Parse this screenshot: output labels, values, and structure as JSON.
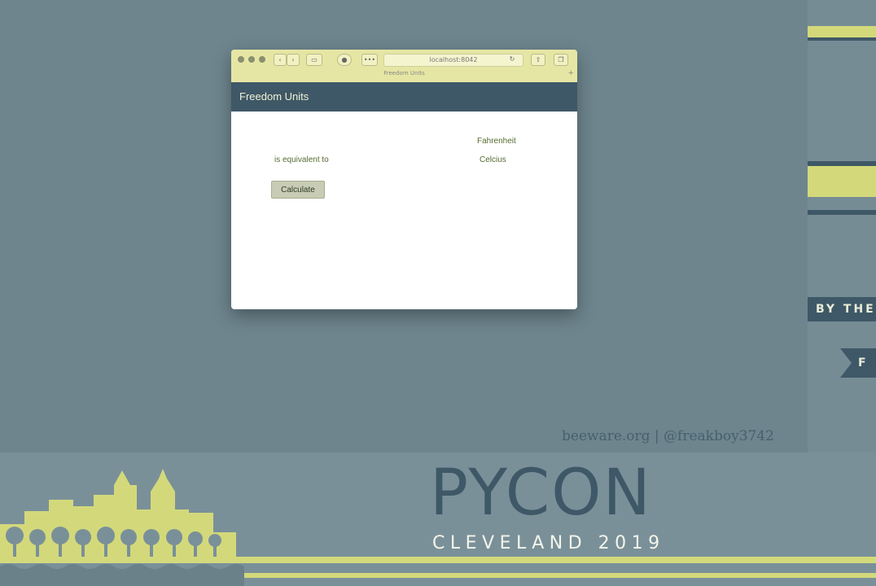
{
  "browser": {
    "url": "localhost:8042",
    "tab_title": "Freedom Units"
  },
  "app": {
    "title": "Freedom Units",
    "fahrenheit_label": "Fahrenheit",
    "equivalent_label": "is equivalent to",
    "celsius_label": "Celcius",
    "calculate_label": "Calculate"
  },
  "slide": {
    "credit": "beeware.org | @freakboy3742",
    "side_text": "BY THE",
    "side_ribbon": "F"
  },
  "footer": {
    "title": "PYCON",
    "subtitle": "CLEVELAND 2019"
  },
  "colors": {
    "background": "#6e858e",
    "header": "#3f5867",
    "accent": "#d3d97a"
  }
}
